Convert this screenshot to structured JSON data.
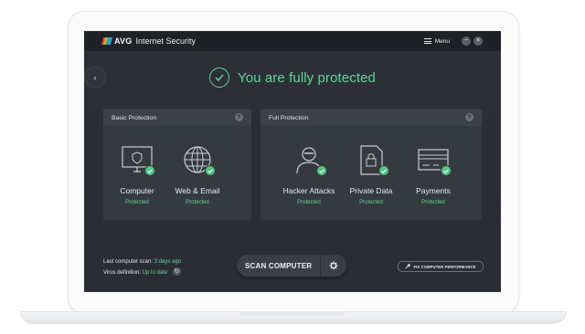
{
  "window": {
    "logo_text": "AVG",
    "product_name": "Internet Security",
    "menu_label": "Menu",
    "minimize_glyph": "−",
    "close_glyph": "×"
  },
  "nav": {
    "back_glyph": "‹"
  },
  "status": {
    "headline": "You are fully protected"
  },
  "panels": [
    {
      "title": "Basic Protection",
      "help": "?",
      "items": [
        {
          "icon": "monitor-icon",
          "label": "Computer",
          "status": "Protected"
        },
        {
          "icon": "globe-icon",
          "label": "Web & Email",
          "status": "Protected"
        }
      ]
    },
    {
      "title": "Full Protection",
      "help": "?",
      "items": [
        {
          "icon": "hacker-icon",
          "label": "Hacker Attacks",
          "status": "Protected"
        },
        {
          "icon": "lock-file-icon",
          "label": "Private Data",
          "status": "Protected"
        },
        {
          "icon": "credit-card-icon",
          "label": "Payments",
          "status": "Protected"
        }
      ]
    }
  ],
  "footer": {
    "last_scan_label": "Last computer scan:",
    "last_scan_value": "3 days ago",
    "virus_def_label": "Virus definition:",
    "virus_def_value": "Up to date",
    "scan_button": "SCAN COMPUTER",
    "fix_button": "FIX COMPUTER PERFORMANCE"
  },
  "colors": {
    "accent_green": "#5fd598",
    "badge_green": "#4fc582",
    "screen_bg": "#2c3036",
    "panel_bg": "#353a41",
    "logo_colors": [
      "#e43b2c",
      "#f7a21b",
      "#4db848",
      "#2c9fd8"
    ]
  }
}
